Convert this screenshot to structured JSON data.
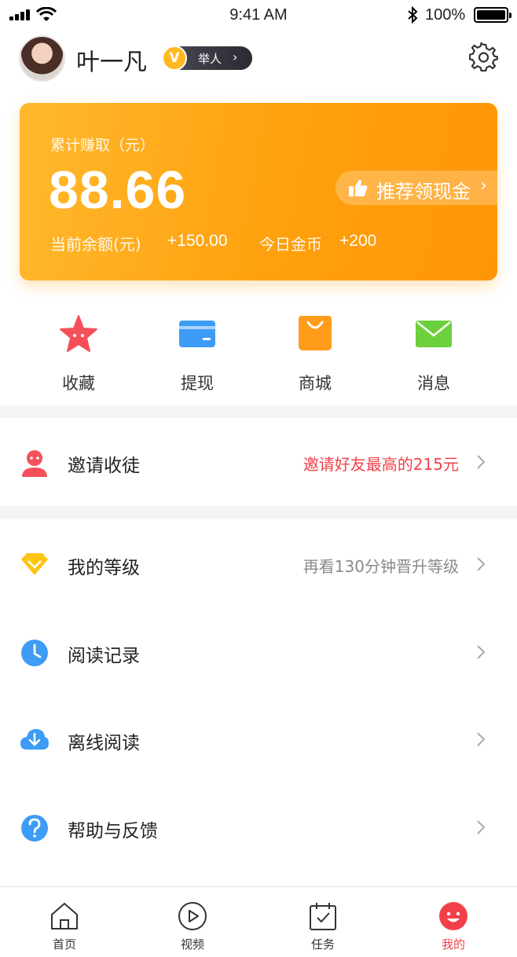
{
  "status_bar": {
    "time": "9:41 AM",
    "battery": "100%"
  },
  "profile": {
    "name": "叶一凡",
    "level_coin": "V",
    "level_label": "举人"
  },
  "earnings": {
    "label": "累计赚取（元）",
    "amount": "88.66",
    "recommend_label": "推荐领现金",
    "balance_label": "当前余额(元)",
    "balance_value": "+150.00",
    "coins_label": "今日金币",
    "coins_value": "+200"
  },
  "quick_actions": [
    {
      "label": "收藏",
      "icon": "star-icon",
      "color": "#f5505a"
    },
    {
      "label": "提现",
      "icon": "card-icon",
      "color": "#3d9cf5"
    },
    {
      "label": "商城",
      "icon": "shopping-bag-icon",
      "color": "#ff9c1a"
    },
    {
      "label": "消息",
      "icon": "envelope-icon",
      "color": "#6ccf3c"
    }
  ],
  "menu": [
    {
      "title": "邀请收徒",
      "hint": "邀请好友最高的215元",
      "icon": "invite-user-icon",
      "color": "#f5505a"
    },
    {
      "title": "我的等级",
      "hint": "再看130分钟晋升等级",
      "icon": "diamond-icon",
      "color": "#ffc514"
    },
    {
      "title": "阅读记录",
      "hint": "",
      "icon": "clock-icon",
      "color": "#3d9cf5"
    },
    {
      "title": "离线阅读",
      "hint": "",
      "icon": "cloud-download-icon",
      "color": "#3d9cf5"
    },
    {
      "title": "帮助与反馈",
      "hint": "",
      "icon": "help-icon",
      "color": "#3d9cf5"
    }
  ],
  "tabs": [
    {
      "label": "首页",
      "icon": "home-icon"
    },
    {
      "label": "视频",
      "icon": "play-icon"
    },
    {
      "label": "任务",
      "icon": "task-calendar-icon"
    },
    {
      "label": "我的",
      "icon": "smiley-icon",
      "active": true
    }
  ],
  "colors": {
    "accent": "#f2404a",
    "card_start": "#ffb92e",
    "card_end": "#ff9606"
  }
}
